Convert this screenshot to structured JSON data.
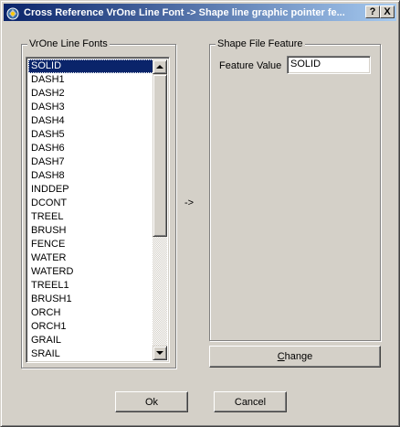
{
  "window": {
    "title": "Cross Reference VrOne Line Font -> Shape line graphic pointer fe...",
    "help_label": "?",
    "close_label": "X"
  },
  "fonts_group": {
    "title": "VrOne Line Fonts",
    "items": [
      "SOLID",
      "DASH1",
      "DASH2",
      "DASH3",
      "DASH4",
      "DASH5",
      "DASH6",
      "DASH7",
      "DASH8",
      "INDDEP",
      "DCONT",
      "TREEL",
      "BRUSH",
      "FENCE",
      "WATER",
      "WATERD",
      "TREEL1",
      "BRUSH1",
      "ORCH",
      "ORCH1",
      "GRAIL",
      "SRAIL"
    ],
    "selected": "SOLID"
  },
  "arrow_label": "->",
  "shape_group": {
    "title": "Shape File Feature",
    "feature_label": "Feature Value",
    "feature_value": "SOLID"
  },
  "buttons": {
    "change_prefix": "C",
    "change_rest": "hange",
    "ok": "Ok",
    "cancel": "Cancel"
  }
}
